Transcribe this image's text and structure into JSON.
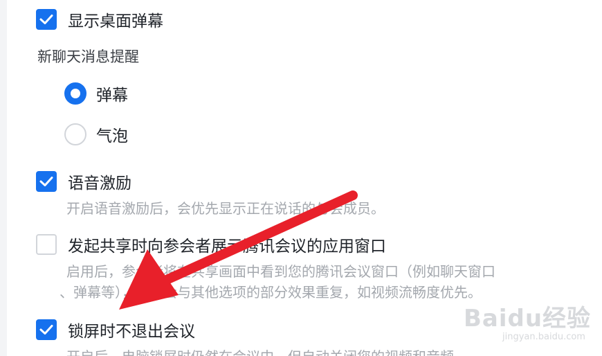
{
  "settings": {
    "show_danmaku": {
      "label": "显示桌面弹幕",
      "checked": true
    },
    "new_message_title": "新聊天消息提醒",
    "message_options": [
      {
        "label": "弹幕",
        "selected": true
      },
      {
        "label": "气泡",
        "selected": false
      }
    ],
    "voice_motivation": {
      "label": "语音激励",
      "checked": true,
      "description": "开启语音激励后，会优先显示正在说话的与会成员。"
    },
    "share_window": {
      "label": "发起共享时向参会者展示腾讯会议的应用窗口",
      "checked": false,
      "description_line1": "启用后，参会者将在共享画面中看到您的腾讯会议窗口（例如聊天窗口",
      "description_line2": "、弹幕等），可能会与其他选项的部分效果重复，如视频流畅度优先。"
    },
    "lock_screen": {
      "label": "锁屏时不退出会议",
      "checked": true,
      "description": "开启后，电脑锁屏时仍然在会议中，但自动关闭您的视频和音频"
    }
  },
  "colors": {
    "accent": "#1671ee",
    "arrow": "#e8202a"
  },
  "watermark": {
    "main": "Baidu经验",
    "sub": "jingyan.baidu.com"
  },
  "icons": {
    "check": "check-icon",
    "arrow": "red-arrow-annotation"
  }
}
